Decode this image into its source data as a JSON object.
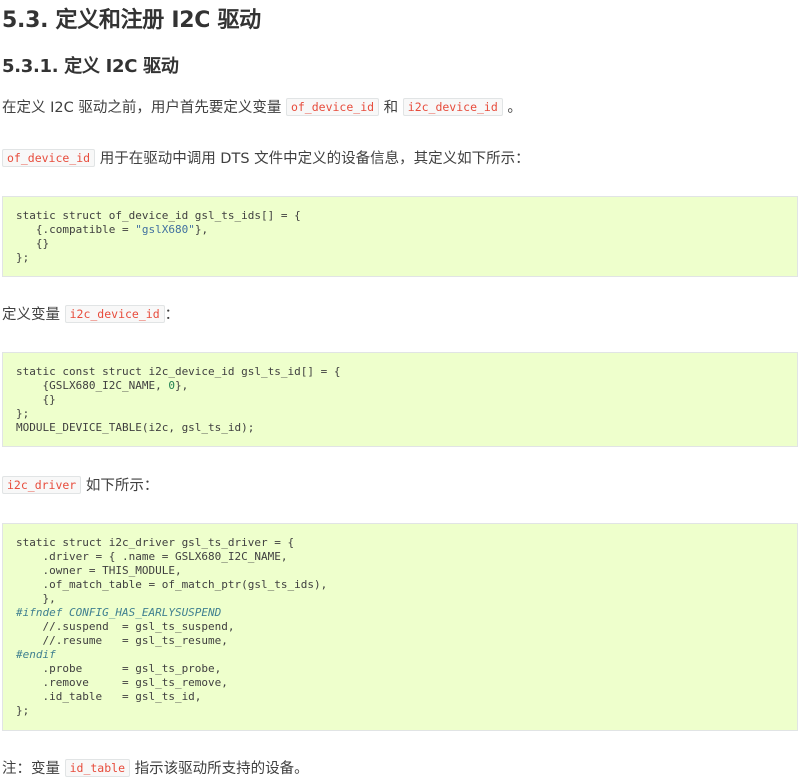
{
  "section_title": "5.3. 定义和注册 I2C 驱动",
  "subsection_title": "5.3.1. 定义 I2C 驱动",
  "para1": {
    "text_before": "在定义 I2C 驱动之前，用户首先要定义变量 ",
    "code1": "of_device_id",
    "text_mid": " 和 ",
    "code2": "i2c_device_id",
    "text_after": " 。"
  },
  "para2": {
    "code": "of_device_id",
    "text": " 用于在驱动中调用 DTS 文件中定义的设备信息，其定义如下所示："
  },
  "code_block1": {
    "line1": "static struct of_device_id gsl_ts_ids[] = {",
    "line2_pre": "   {.compatible = ",
    "line2_str": "\"gslX680\"",
    "line2_post": "},",
    "line3": "   {}",
    "line4": "};"
  },
  "para3": {
    "text": "定义变量 ",
    "code": "i2c_device_id",
    "text_after": "："
  },
  "code_block2": {
    "line1": "static const struct i2c_device_id gsl_ts_id[] = {",
    "line2_pre": "    {GSLX680_I2C_NAME, ",
    "line2_num": "0",
    "line2_post": "},",
    "line3": "    {}",
    "line4": "};",
    "line5": "MODULE_DEVICE_TABLE(i2c, gsl_ts_id);"
  },
  "para4": {
    "code": "i2c_driver",
    "text": " 如下所示："
  },
  "code_block3": {
    "line1": "static struct i2c_driver gsl_ts_driver = {",
    "line2": "    .driver = { .name = GSLX680_I2C_NAME,",
    "line3": "    .owner = THIS_MODULE,",
    "line4": "    .of_match_table = of_match_ptr(gsl_ts_ids),",
    "line5": "    },",
    "line6": "#ifndef CONFIG_HAS_EARLYSUSPEND",
    "line7": "    //.suspend  = gsl_ts_suspend,",
    "line8": "    //.resume   = gsl_ts_resume,",
    "line9": "#endif",
    "line10": "    .probe      = gsl_ts_probe,",
    "line11": "    .remove     = gsl_ts_remove,",
    "line12": "    .id_table   = gsl_ts_id,",
    "line13": "};"
  },
  "para5": {
    "text": "注：变量 ",
    "code": "id_table",
    "text_after": " 指示该驱动所支持的设备。"
  }
}
